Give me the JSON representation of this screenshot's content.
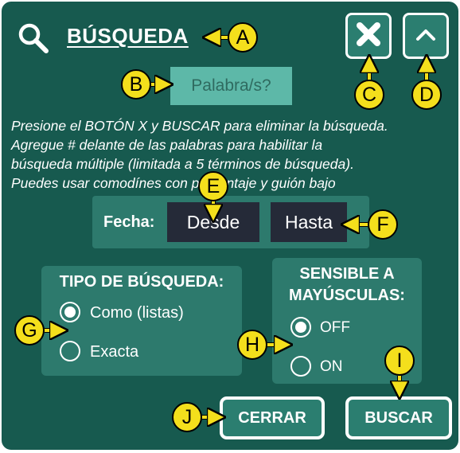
{
  "header": {
    "title": "BÚSQUEDA",
    "search_icon": "search-icon",
    "close_icon": "close-icon",
    "collapse_icon": "chevron-up-icon"
  },
  "search": {
    "placeholder": "Palabra/s?"
  },
  "instructions": [
    "Presione el BOTÓN X y BUSCAR para eliminar la búsqueda.",
    "Agregue # delante de las palabras para habilitar la",
    "búsqueda múltiple (limitada a 5 términos de búsqueda).",
    "Puedes usar comodínes con porcentaje y guión bajo"
  ],
  "date": {
    "label": "Fecha:",
    "from": "Desde",
    "to": "Hasta"
  },
  "search_type": {
    "title": "TIPO DE BÚSQUEDA:",
    "options": [
      {
        "label": "Como (listas)",
        "selected": true
      },
      {
        "label": "Exacta",
        "selected": false
      }
    ]
  },
  "case_sensitive": {
    "title_line1": "SENSIBLE A",
    "title_line2": "MAYÚSCULAS:",
    "options": [
      {
        "label": "OFF",
        "selected": true
      },
      {
        "label": "ON",
        "selected": false
      }
    ]
  },
  "actions": {
    "close": "CERRAR",
    "search": "BUSCAR"
  },
  "markers": [
    "A",
    "B",
    "C",
    "D",
    "E",
    "F",
    "G",
    "H",
    "I",
    "J"
  ],
  "colors": {
    "background": "#175a4f",
    "panel": "#2d7a6d",
    "input": "#5db8a8",
    "date_button": "#252a38",
    "marker": "#f4df1c"
  }
}
